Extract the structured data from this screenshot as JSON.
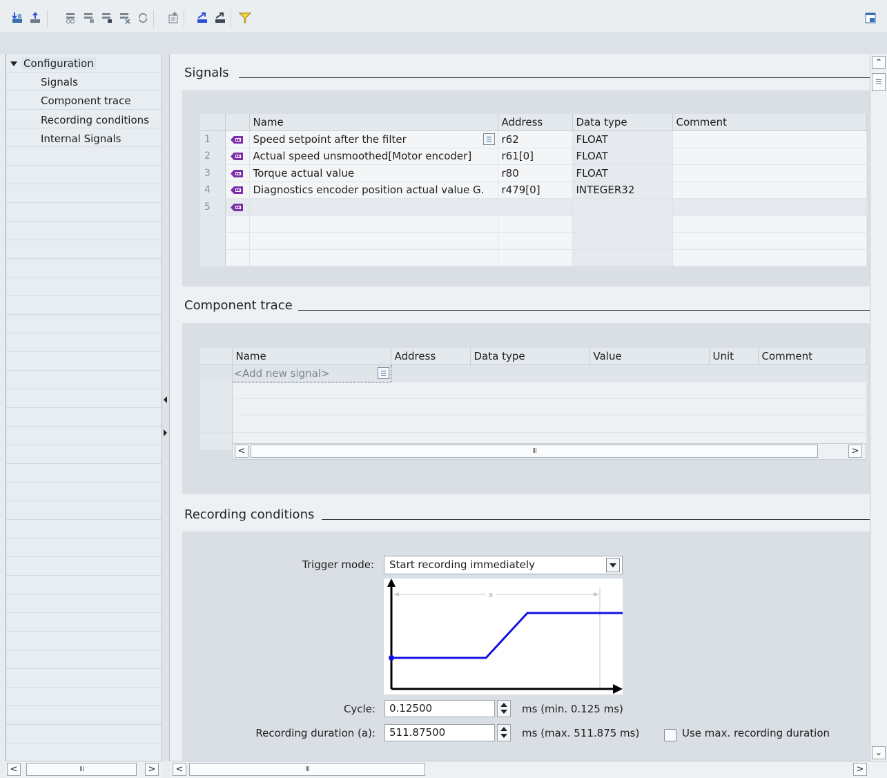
{
  "toolbar": {
    "buttons": [
      "download-to-device-icon",
      "upload-from-device-icon",
      "signals-icon-1",
      "signals-icon-2",
      "signals-icon-3",
      "signals-delete-icon",
      "refresh-icon",
      "add-signal-icon",
      "export-icon",
      "import-icon",
      "filter-icon"
    ],
    "right_button": "window-layout-icon"
  },
  "tree": {
    "root": "Configuration",
    "items": [
      "Signals",
      "Component trace",
      "Recording conditions",
      "Internal Signals"
    ]
  },
  "signals": {
    "title": "Signals",
    "columns": [
      "",
      "",
      "Name",
      "Address",
      "Data type",
      "Comment"
    ],
    "rows": [
      {
        "num": "1",
        "name": "Speed setpoint after the filter",
        "address": "r62",
        "data_type": "FLOAT",
        "comment": ""
      },
      {
        "num": "2",
        "name": "Actual speed unsmoothed[Motor encoder]",
        "address": "r61[0]",
        "data_type": "FLOAT",
        "comment": ""
      },
      {
        "num": "3",
        "name": "Torque actual value",
        "address": "r80",
        "data_type": "FLOAT",
        "comment": ""
      },
      {
        "num": "4",
        "name": "Diagnostics encoder position actual value G.",
        "address": "r479[0]",
        "data_type": "INTEGER32",
        "comment": ""
      },
      {
        "num": "5",
        "name": "",
        "address": "",
        "data_type": "",
        "comment": ""
      }
    ]
  },
  "component_trace": {
    "title": "Component trace",
    "columns": [
      "Name",
      "Address",
      "Data type",
      "Value",
      "Unit",
      "Comment"
    ],
    "add_placeholder": "<Add new signal>"
  },
  "recording": {
    "title": "Recording conditions",
    "trigger_mode_label": "Trigger mode:",
    "trigger_mode_value": "Start recording immediately",
    "diagram_label": "a",
    "cycle_label": "Cycle:",
    "cycle_value": "0.12500",
    "cycle_unit": "ms (min. 0.125 ms)",
    "duration_label": "Recording duration (a):",
    "duration_value": "511.87500",
    "duration_unit": "ms (max. 511.875 ms)",
    "max_duration_label": "Use max. recording duration",
    "max_duration_checked": false
  },
  "scroll": {
    "grip": "III"
  },
  "colors": {
    "accent": "#2b4fd6",
    "selection": "#dde6ee"
  }
}
